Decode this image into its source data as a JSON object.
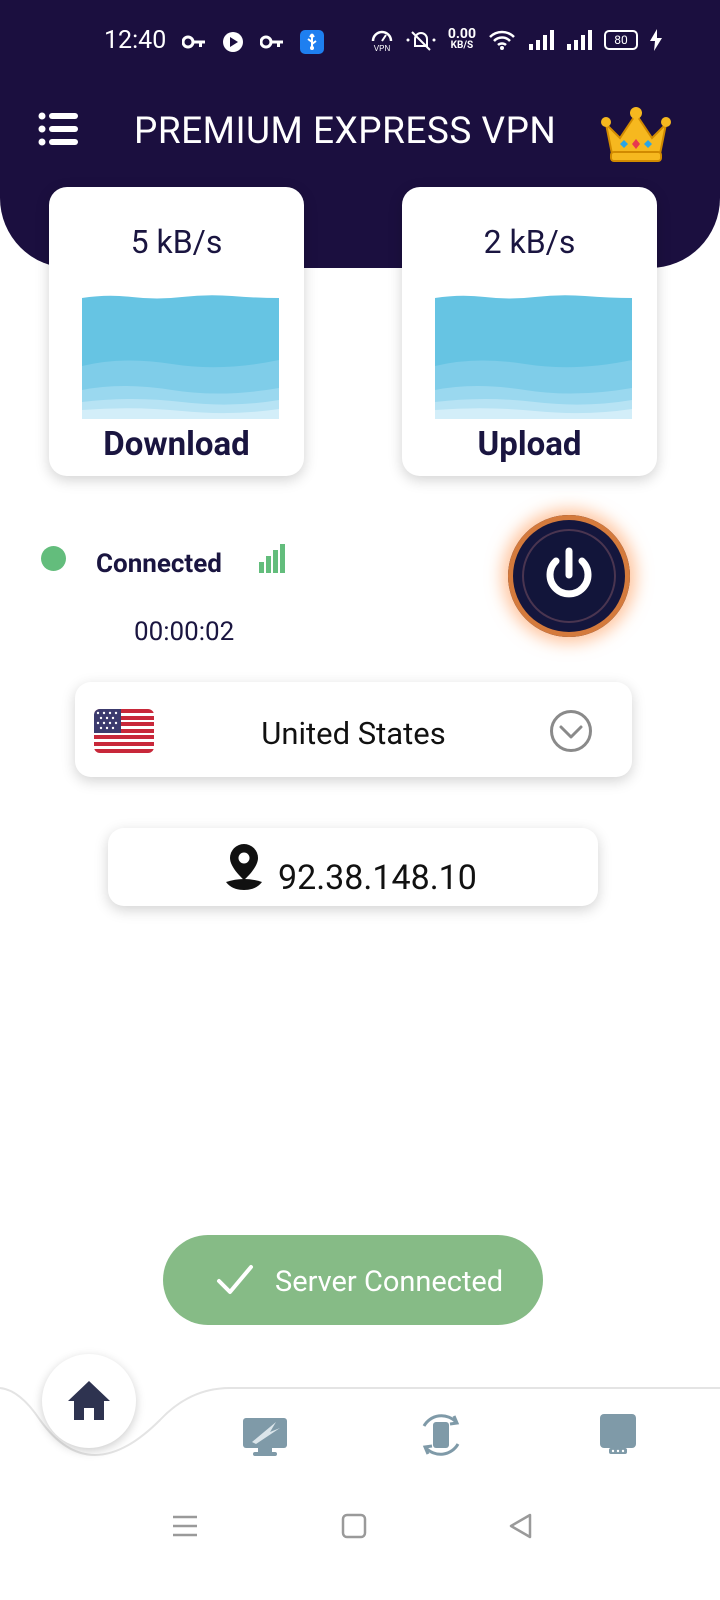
{
  "status_bar": {
    "time": "12:40",
    "net_speed_value": "0.00",
    "net_speed_unit": "KB/S",
    "vpn_label": "VPN",
    "battery": "80"
  },
  "header": {
    "title": "PREMIUM EXPRESS VPN"
  },
  "download_card": {
    "value": "5 kB/s",
    "label": "Download"
  },
  "upload_card": {
    "value": "2 kB/s",
    "label": "Upload"
  },
  "connection": {
    "status": "Connected",
    "timer": "00:00:02"
  },
  "country": {
    "name": "United States"
  },
  "ip": {
    "address": "92.38.148.10"
  },
  "toast": {
    "message": "Server Connected"
  },
  "colors": {
    "header_bg": "#1b0f3f",
    "connected_green": "#63bd7c",
    "toast_green": "#86bb86",
    "wave_blue": "#6cc5e3"
  }
}
